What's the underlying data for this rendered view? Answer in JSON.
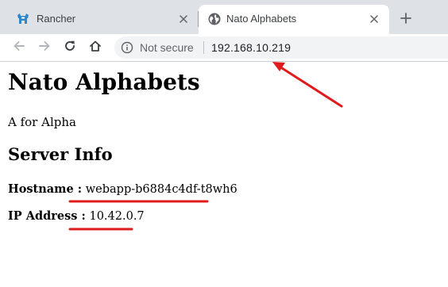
{
  "browser": {
    "tabs": [
      {
        "title": "Rancher",
        "active": false,
        "favicon": "rancher-cow-icon"
      },
      {
        "title": "Nato Alphabets",
        "active": true,
        "favicon": "globe-icon"
      }
    ],
    "address_bar": {
      "security_label": "Not secure",
      "url": "192.168.10.219"
    }
  },
  "page": {
    "heading": "Nato Alphabets",
    "tagline": "A for Alpha",
    "server_info": {
      "heading": "Server Info",
      "hostname_label": "Hostname :",
      "hostname_value": "webapp-b6884c4df-t8wh6",
      "ip_label": "IP Address :",
      "ip_value": "10.42.0.7"
    }
  },
  "colors": {
    "annotation": "#e01b1b",
    "tabstrip": "#dee1e6",
    "rancher_brand": "#2f86c8"
  }
}
